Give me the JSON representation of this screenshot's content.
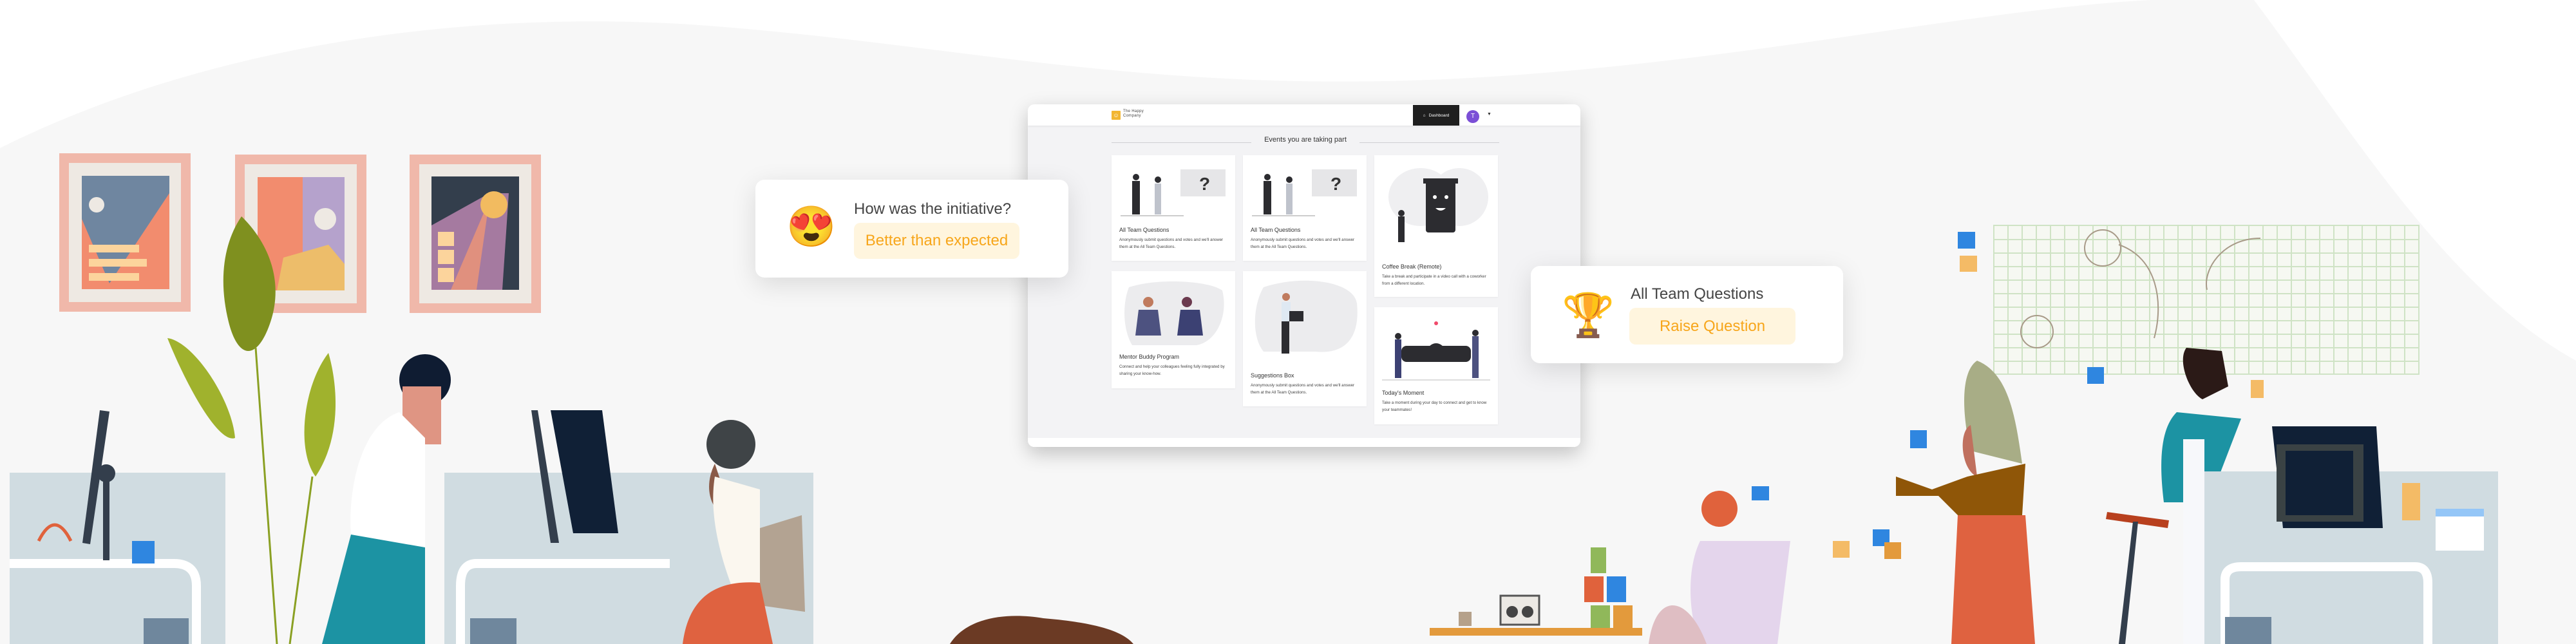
{
  "app": {
    "logo_text": "The Happy Company",
    "nav": {
      "dashboard_label": "Dashboard",
      "avatar_initial": "T"
    },
    "section_title": "Events you are taking part",
    "events": [
      {
        "title": "All Team Questions",
        "description": "Anonymously submit questions and votes and we'll answer them at the All Team Questions."
      },
      {
        "title": "All Team Questions",
        "description": "Anonymously submit questions and votes and we'll answer them at the All Team Questions."
      },
      {
        "title": "Coffee Break (Remote)",
        "description": "Take a break and participate in a video call with a coworker from a different location."
      },
      {
        "title": "Mentor Buddy Program",
        "description": "Connect and help your colleagues feeling fully integrated by sharing your know-how."
      },
      {
        "title": "Suggestions Box",
        "description": "Anonymously submit questions and votes and we'll answer them at the All Team Questions."
      },
      {
        "title": "Today's Moment",
        "description": "Take a moment during your day to connect and get to know your teammates!"
      }
    ]
  },
  "feedback_popup": {
    "icon": "heart-eyes-emoji-icon",
    "emoji": "😍",
    "question": "How was the initiative?",
    "answer_label": "Better than expected"
  },
  "question_popup": {
    "icon": "trophy-icon",
    "emoji": "🏆",
    "title": "All Team Questions",
    "button_label": "Raise Question"
  },
  "colors": {
    "accent": "#f7a61b",
    "accent_bg": "#fff5de",
    "avatar": "#7b4fd6",
    "dashboard_button": "#1f1f1f"
  }
}
